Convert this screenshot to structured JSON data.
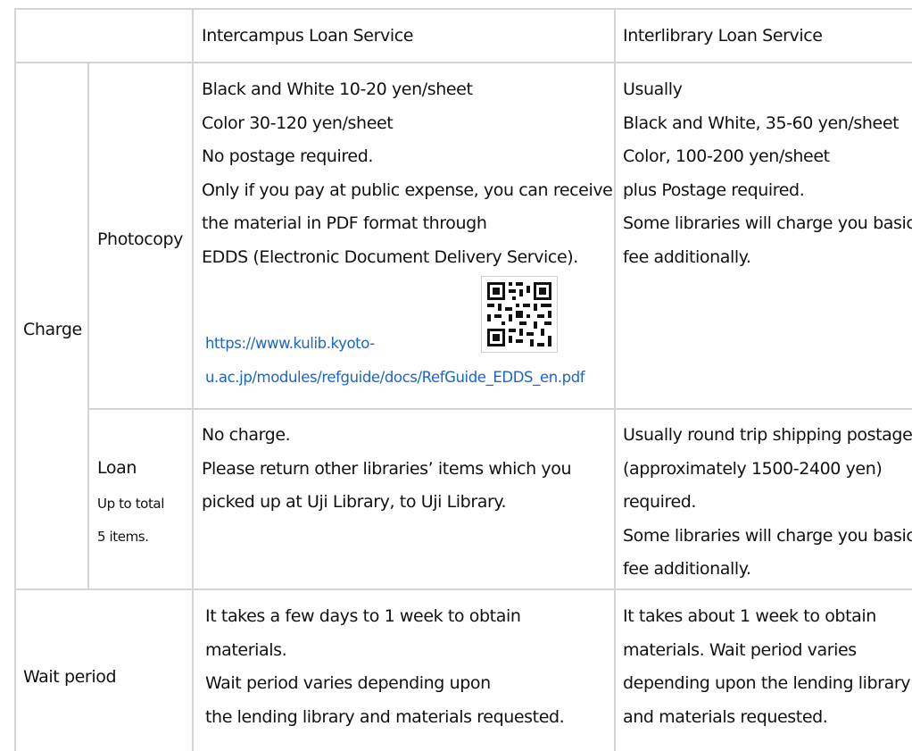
{
  "header": {
    "intercampus": "Intercampus Loan Service",
    "interlibrary": "Interlibrary Loan Service"
  },
  "charge": {
    "label": "Charge",
    "photocopy": {
      "label": "Photocopy",
      "intercampus_lines": [
        "Black and White 10-20 yen/sheet",
        "Color 30-120 yen/sheet",
        "No postage required.",
        "Only if you pay at public expense, you can receive",
        "the material in PDF format through",
        "EDDS (Electronic Document Delivery Service)."
      ],
      "link_lines": [
        "https://www.kulib.kyoto-",
        "u.ac.jp/modules/refguide/docs/RefGuide_EDDS_en.pdf"
      ],
      "interlibrary_lines": [
        "Usually",
        "Black and White, 35-60 yen/sheet",
        "Color, 100-200 yen/sheet",
        "plus Postage required.",
        "Some libraries will charge you basic",
        "fee additionally."
      ]
    },
    "loan": {
      "label": "Loan",
      "sublabel_lines": [
        "Up to total",
        "5 items."
      ],
      "intercampus_lines": [
        "No charge.",
        "Please return other libraries’ items which you",
        "picked up at Uji Library, to Uji Library."
      ],
      "interlibrary_lines": [
        "Usually round trip shipping postage",
        "(approximately 1500-2400 yen)",
        "required.",
        "Some libraries will charge you basic",
        "fee additionally."
      ]
    }
  },
  "wait": {
    "label": "Wait period",
    "intercampus_lines": [
      "It takes a few days to 1 week to obtain",
      "materials.",
      "Wait period varies depending upon",
      "the lending library and materials requested."
    ],
    "interlibrary_lines": [
      "It takes about 1 week to obtain",
      "materials. Wait period varies",
      "depending upon the lending library",
      "and materials requested."
    ]
  }
}
